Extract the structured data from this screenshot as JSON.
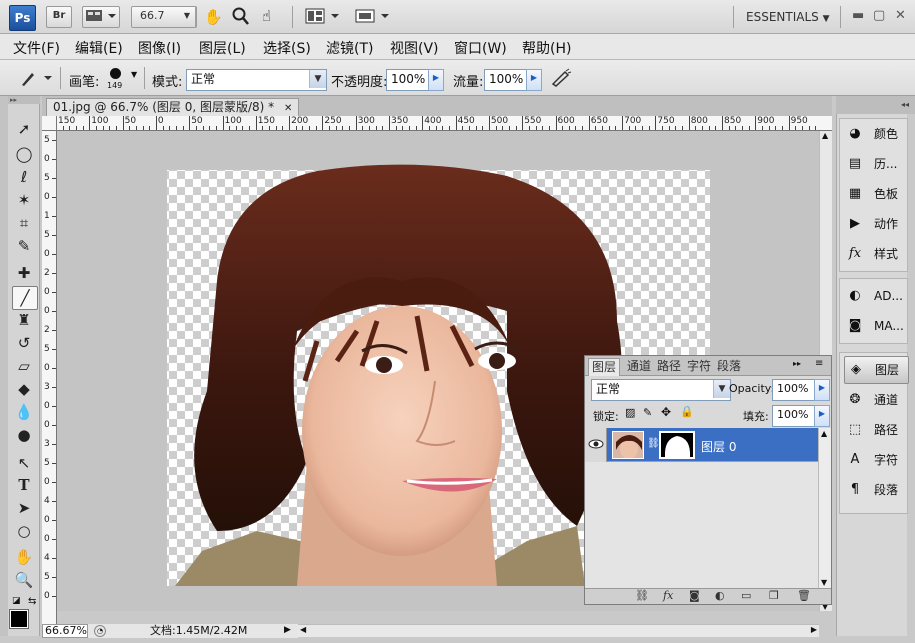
{
  "appbar": {
    "logo": "Ps",
    "bridge": "Br",
    "zoom": "66.7",
    "workspace": "ESSENTIALS",
    "icons": [
      "hand-icon",
      "zoom-icon",
      "rotate-view-icon",
      "arrange-documents-icon",
      "screen-mode-icon"
    ]
  },
  "menu": [
    "文件(F)",
    "编辑(E)",
    "图像(I)",
    "图层(L)",
    "选择(S)",
    "滤镜(T)",
    "视图(V)",
    "窗口(W)",
    "帮助(H)"
  ],
  "options": {
    "brush_label": "画笔:",
    "brush_size": "149",
    "mode_label": "模式:",
    "mode_value": "正常",
    "opacity_label": "不透明度:",
    "opacity_value": "100%",
    "flow_label": "流量:",
    "flow_value": "100%"
  },
  "document": {
    "tab_title": "01.jpg @ 66.7% (图层 0, 图层蒙版/8) *",
    "ruler_top": [
      "150",
      "100",
      "50",
      "0",
      "50",
      "100",
      "150",
      "200",
      "250",
      "300",
      "350",
      "400",
      "450",
      "500",
      "550",
      "600",
      "650",
      "700",
      "750",
      "800",
      "850",
      "900",
      "950"
    ],
    "ruler_left": [
      "5",
      "0",
      "5",
      "0",
      "1",
      "5",
      "0",
      "2",
      "0",
      "0",
      "2",
      "5",
      "0",
      "3",
      "0",
      "0",
      "3",
      "5",
      "0",
      "4",
      "0",
      "0",
      "4",
      "5",
      "0"
    ],
    "zoom_status": "66.67%",
    "doc_status": "文档:1.45M/2.42M"
  },
  "dock": {
    "group1": [
      "颜色",
      "历...",
      "色板",
      "动作",
      "样式"
    ],
    "group2": [
      "AD...",
      "MA..."
    ],
    "group3": [
      "图层",
      "通道",
      "路径",
      "字符",
      "段落"
    ]
  },
  "layers_panel": {
    "tabs": [
      "图层",
      "通道",
      "路径",
      "字符",
      "段落"
    ],
    "blend_mode": "正常",
    "opacity_label": "Opacity:",
    "opacity_value": "100%",
    "lock_label": "锁定:",
    "fill_label": "填充:",
    "fill_value": "100%",
    "layer_name": "图层 0"
  },
  "colors": {
    "selection_blue": "#3a6fc4",
    "panel_gray": "#d7d7d7",
    "canvas_bg": "#c4c4c4"
  }
}
